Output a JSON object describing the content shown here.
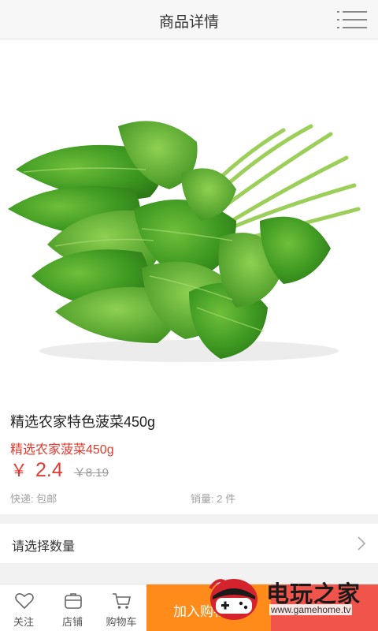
{
  "header": {
    "title": "商品详情",
    "menu_icon": "list-menu-icon"
  },
  "product": {
    "name": "精选农家特色菠菜450g",
    "subtitle": "精选农家菠菜450g",
    "currency": "￥",
    "price": "2.4",
    "original_price": "￥8.19",
    "shipping": "快递: 包邮",
    "sales": "销量: 2 件"
  },
  "quantity": {
    "label": "请选择数量"
  },
  "bottom_bar": {
    "follow_label": "关注",
    "store_label": "店铺",
    "cart_label": "购物车",
    "add_to_cart_label": "加入购物车",
    "colors": {
      "add_to_cart": "#ff8c1a",
      "buy_now": "#f0544a",
      "price": "#e23a2e"
    }
  },
  "watermark": {
    "title": "电玩之家",
    "url": "www.gamehome.tv"
  }
}
